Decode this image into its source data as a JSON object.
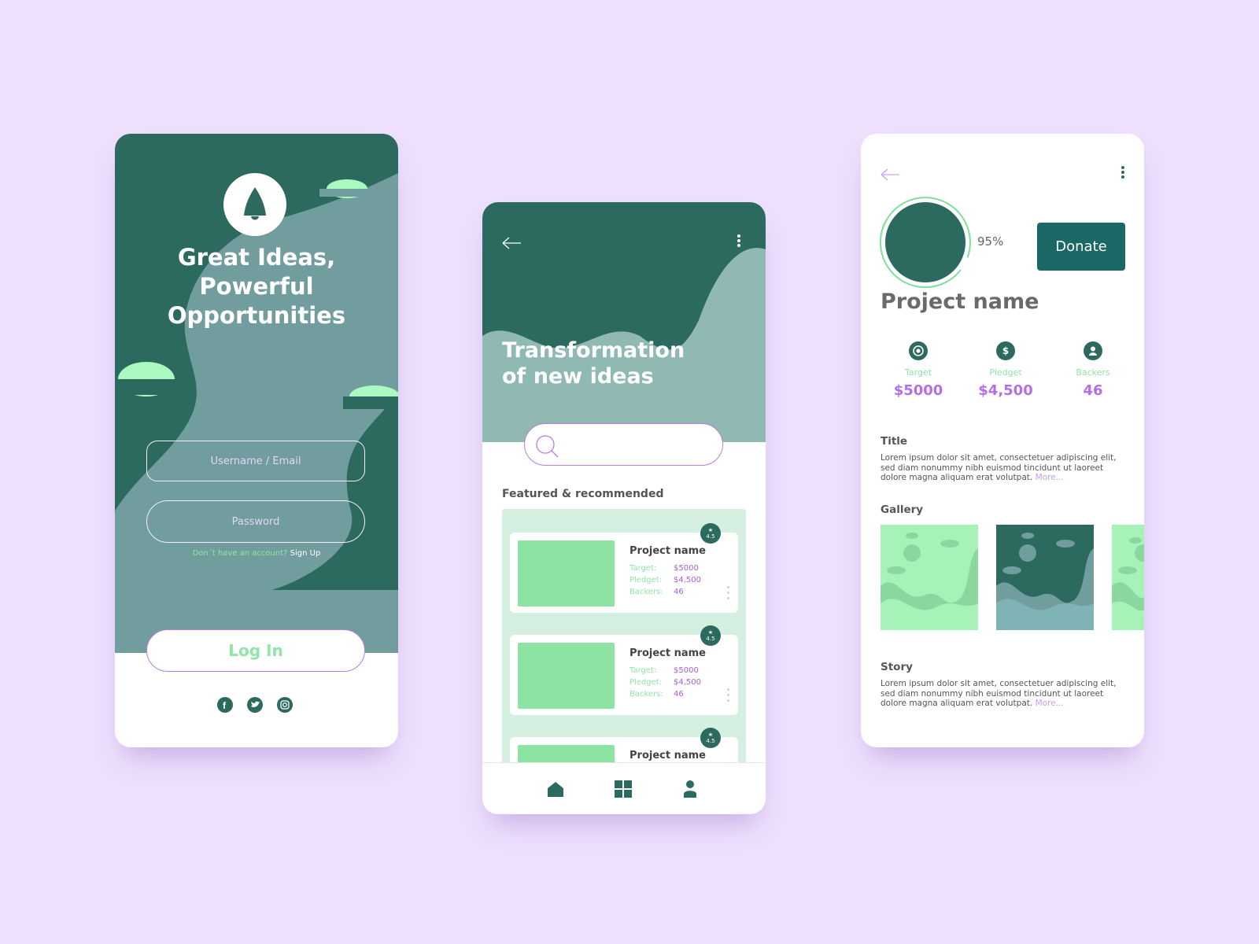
{
  "login_screen": {
    "headline": [
      "Great Ideas,",
      "Powerful",
      "Opportunities"
    ],
    "username_placeholder": "Username / Email",
    "password_placeholder": "Password",
    "signup_question": "Don´t have  an account?",
    "signup_link": "Sign Up",
    "login_button": "Log In",
    "social_icons": [
      "facebook-icon",
      "twitter-icon",
      "instagram-icon"
    ]
  },
  "browse_screen": {
    "title": [
      "Transformation",
      "of new ideas"
    ],
    "search_icon": "search-icon",
    "section_title": "Featured & recommended",
    "cards": [
      {
        "name": "Project name",
        "rating": "4.5",
        "target_label": "Target:",
        "target": "$5000",
        "pledged_label": "Pledget:",
        "pledged": "$4,500",
        "backers_label": "Backers:",
        "backers": "46"
      },
      {
        "name": "Project name",
        "rating": "4.5",
        "target_label": "Target:",
        "target": "$5000",
        "pledged_label": "Pledget:",
        "pledged": "$4,500",
        "backers_label": "Backers:",
        "backers": "46"
      },
      {
        "name": "Project name",
        "rating": "4.5"
      }
    ],
    "nav_icons": [
      "home-icon",
      "grid-icon",
      "profile-icon"
    ]
  },
  "detail_screen": {
    "progress_label": "95%",
    "progress": 0.95,
    "donate_button": "Donate",
    "project_name": "Project name",
    "stats": [
      {
        "label": "Target",
        "value": "$5000",
        "icon": "target-icon"
      },
      {
        "label": "Pledget",
        "value": "$4,500",
        "icon": "dollar-icon"
      },
      {
        "label": "Backers",
        "value": "46",
        "icon": "user-icon"
      }
    ],
    "title_heading": "Title",
    "title_text": "Lorem ipsum dolor sit amet, consectetuer adipiscing elit, sed diam nonummy nibh euismod tincidunt ut laoreet dolore magna aliquam erat volutpat.",
    "more_link": "More...",
    "gallery_heading": "Gallery",
    "story_heading": "Story",
    "story_text": "Lorem ipsum dolor sit amet, consectetuer adipiscing elit, sed diam nonummy nibh euismod tincidunt ut laoreet dolore magna aliquam erat volutpat.",
    "story_more": "More..."
  },
  "colors": {
    "background": "#eedffd",
    "dark_green": "#2c6a60",
    "muted_teal": "#729d9f",
    "mint": "#a9f9c0",
    "purple": "#b36ee8",
    "donate": "#1b6866"
  }
}
